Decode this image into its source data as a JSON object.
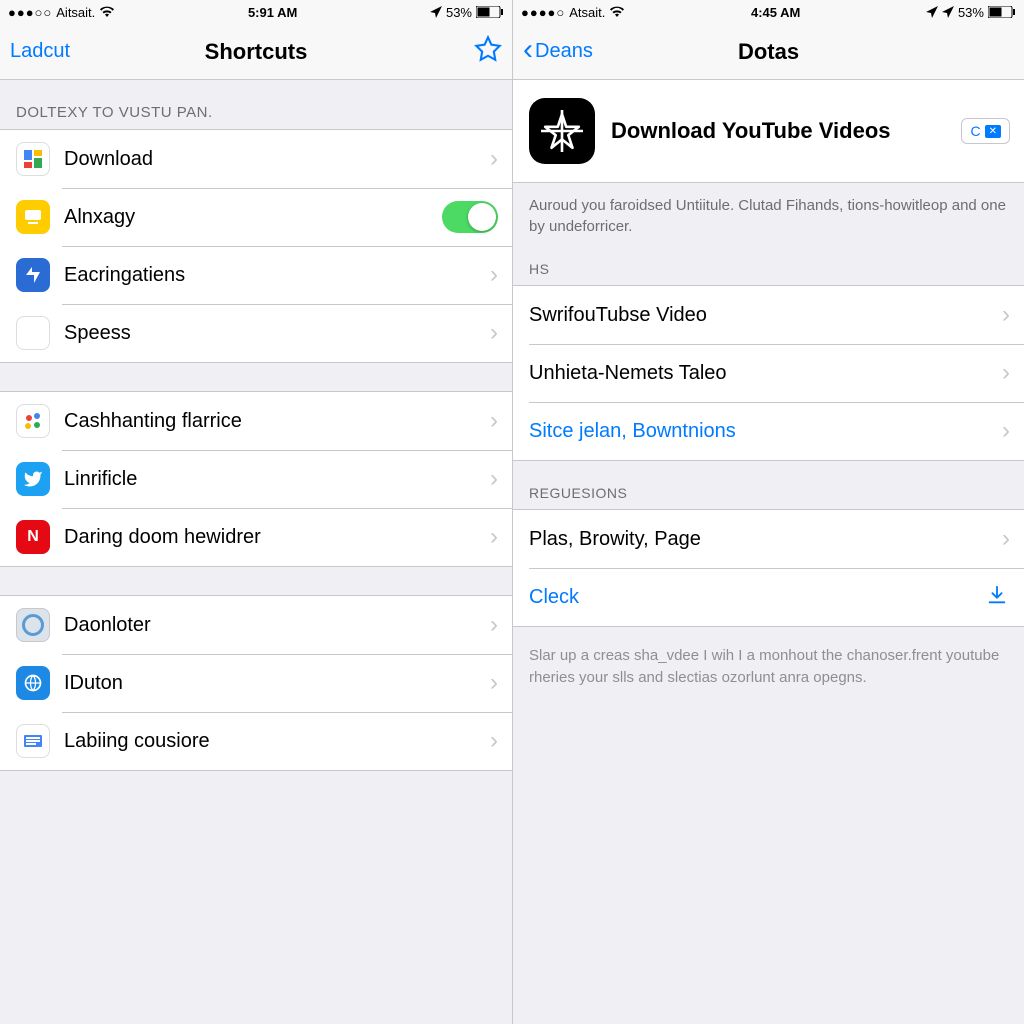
{
  "left": {
    "status": {
      "carrier": "Aitsait.",
      "time": "5:91 AM",
      "battery": "53%"
    },
    "nav": {
      "back": "Ladcut",
      "title": "Shortcuts"
    },
    "section1_header": "DOLTEXY TO VUSTU PAN.",
    "rows1": [
      {
        "label": "Download"
      },
      {
        "label": "Alnxagy",
        "toggle": true
      },
      {
        "label": "Eacringatiens"
      },
      {
        "label": "Speess"
      }
    ],
    "rows2": [
      {
        "label": "Cashhanting flarrice"
      },
      {
        "label": "Linrificle"
      },
      {
        "label": "Daring doom hewidrer"
      }
    ],
    "rows3": [
      {
        "label": "Daonloter"
      },
      {
        "label": "IDuton"
      },
      {
        "label": "Labiing cousiore"
      }
    ]
  },
  "right": {
    "status": {
      "carrier": "Atsait.",
      "time": "4:45 AM",
      "battery": "53%"
    },
    "nav": {
      "back": "Deans",
      "title": "Dotas"
    },
    "detail": {
      "title": "Download YouTube Videos",
      "pill": "C",
      "desc": "Auroud you faroidsed Untiitule. Clutad Fihands, tions-howitleop and one by undeforricer."
    },
    "section_hs": "HS",
    "rows_hs": [
      {
        "label": "SwrifouTubse Video"
      },
      {
        "label": "Unhieta-Nemets Taleo"
      },
      {
        "label": "Sitce jelan, Bowntnions",
        "link": true
      }
    ],
    "section_req": "REGUESIONS",
    "rows_req": [
      {
        "label": "Plas, Browity, Page"
      },
      {
        "label": "Cleck",
        "link": true,
        "download": true
      }
    ],
    "footer": "Slar up a creas sha_vdee I wih I a monhout the chanoser.frent youtube rheries your slls and slectias ozorlunt anra opegns."
  }
}
